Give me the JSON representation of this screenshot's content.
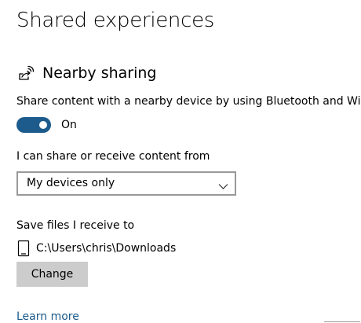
{
  "page": {
    "title": "Shared experiences"
  },
  "nearby_sharing": {
    "icon": "nearby-share-icon",
    "title": "Nearby sharing",
    "description": "Share content with a nearby device by using Bluetooth and Wi-Fi",
    "toggle": {
      "state": "on",
      "label": "On"
    }
  },
  "share_from": {
    "label": "I can share or receive content from",
    "selected": "My devices only",
    "chevron_icon": "chevron-down-icon"
  },
  "save_location": {
    "label": "Save files I receive to",
    "icon": "device-icon",
    "path": "C:\\Users\\chris\\Downloads",
    "change_label": "Change"
  },
  "links": {
    "learn_more": "Learn more"
  },
  "colors": {
    "accent": "#1c5b8c",
    "link": "#1a5a8c",
    "button_bg": "#cccccc",
    "select_border": "#999999"
  }
}
